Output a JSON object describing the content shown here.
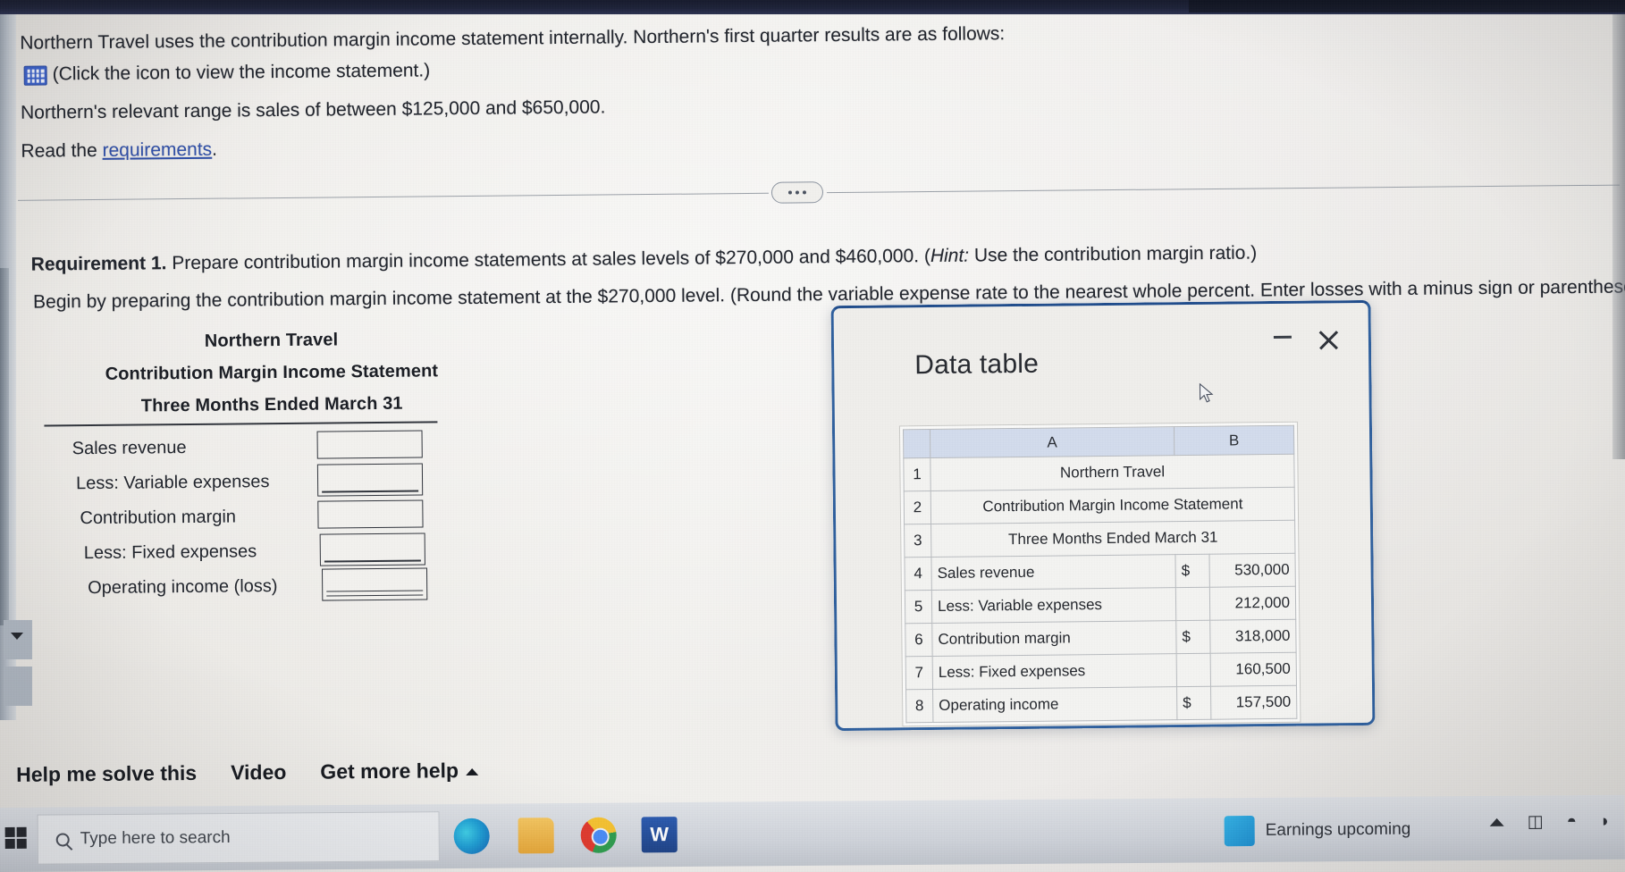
{
  "problem": {
    "intro": "Northern Travel uses the contribution margin income statement internally. Northern's first quarter results are as follows:",
    "icon_line": "(Click the icon to view the income statement.)",
    "relevant_range": "Northern's relevant range is sales of between $125,000 and $650,000.",
    "read_prefix": "Read the ",
    "read_link": "requirements",
    "read_suffix": "."
  },
  "requirement": {
    "label": "Requirement 1.",
    "text": " Prepare contribution margin income statements at sales levels of $270,000 and $460,000. (",
    "hint_word": "Hint:",
    "hint_rest": " Use the contribution margin ratio.)",
    "begin": "Begin by preparing the contribution margin income statement at the $270,000 level. (Round the variable expense rate to the nearest whole percent. Enter losses with a minus sign or parentheses"
  },
  "worksheet": {
    "company": "Northern Travel",
    "statement": "Contribution Margin Income Statement",
    "period": "Three Months Ended March 31",
    "rows": [
      {
        "label": "Sales revenue",
        "value": "",
        "style": "plain"
      },
      {
        "label": "Less: Variable expenses",
        "value": "",
        "style": "under"
      },
      {
        "label": "Contribution margin",
        "value": "",
        "style": "plain"
      },
      {
        "label": "Less: Fixed expenses",
        "value": "",
        "style": "under"
      },
      {
        "label": "Operating income (loss)",
        "value": "",
        "style": "double"
      }
    ]
  },
  "actions": {
    "help": "Help me solve this",
    "video": "Video",
    "more": "Get more help"
  },
  "modal": {
    "title": "Data table",
    "minimize": "minimize",
    "close": "close"
  },
  "sheet": {
    "columns": [
      "",
      "A",
      "B"
    ],
    "rows": [
      {
        "num": "1",
        "kind": "merged",
        "label": "Northern Travel",
        "currency": "",
        "value": ""
      },
      {
        "num": "2",
        "kind": "merged",
        "label": "Contribution Margin Income Statement",
        "currency": "",
        "value": ""
      },
      {
        "num": "3",
        "kind": "merged",
        "label": "Three Months Ended March 31",
        "currency": "",
        "value": ""
      },
      {
        "num": "4",
        "kind": "data",
        "label": "Sales revenue",
        "currency": "$",
        "value": "530,000"
      },
      {
        "num": "5",
        "kind": "data",
        "label": "Less: Variable expenses",
        "currency": "",
        "value": "212,000"
      },
      {
        "num": "6",
        "kind": "data",
        "label": "Contribution margin",
        "currency": "$",
        "value": "318,000"
      },
      {
        "num": "7",
        "kind": "data",
        "label": "Less: Fixed expenses",
        "currency": "",
        "value": "160,500"
      },
      {
        "num": "8",
        "kind": "data",
        "label": "Operating income",
        "currency": "$",
        "value": "157,500"
      }
    ]
  },
  "taskbar": {
    "search_placeholder": "Type here to search",
    "earnings": "Earnings upcoming",
    "word_letter": "W"
  },
  "colors": {
    "modal_border": "#2e5f9e",
    "link": "#2f4fa8",
    "icon_blue": "#3a5fc8",
    "sheet_header": "#d3dced"
  }
}
